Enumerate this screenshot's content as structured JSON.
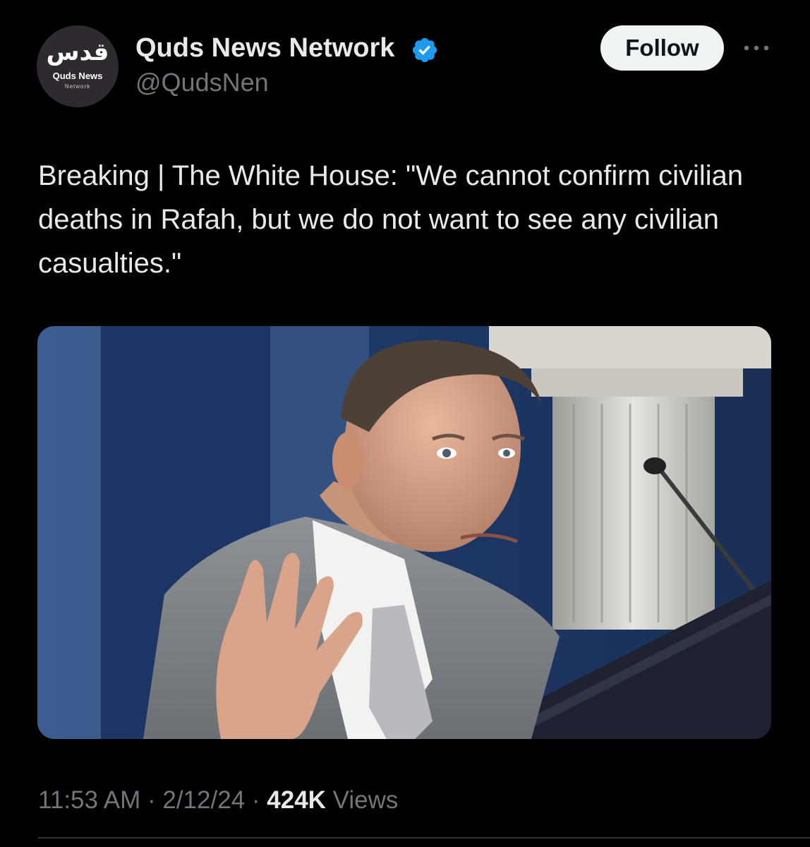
{
  "author": {
    "avatar": {
      "arabic_text": "قدس",
      "name_text": "Quds News",
      "sub_text": "Network",
      "icon": "quds-news-logo"
    },
    "display_name": "Quds News Network",
    "verified_icon": "verified-badge-icon",
    "verified_color": "#1d9bf0",
    "handle": "@QudsNen"
  },
  "actions": {
    "follow_label": "Follow",
    "more_icon": "more-horizontal-icon"
  },
  "tweet": {
    "text": "Breaking | The White House: \"We cannot confirm civilian deaths in Rafah, but we do not want to see any civilian casualties.\"",
    "media_icon": "press-briefing-photo"
  },
  "meta": {
    "time": "11:53 AM",
    "separator": " · ",
    "date": "2/12/24",
    "views_count": "424K",
    "views_label": " Views"
  },
  "colors": {
    "background": "#000000",
    "text_primary": "#e7e9ea",
    "text_secondary": "#71767b",
    "follow_bg": "#eff3f4",
    "accent": "#1d9bf0"
  }
}
